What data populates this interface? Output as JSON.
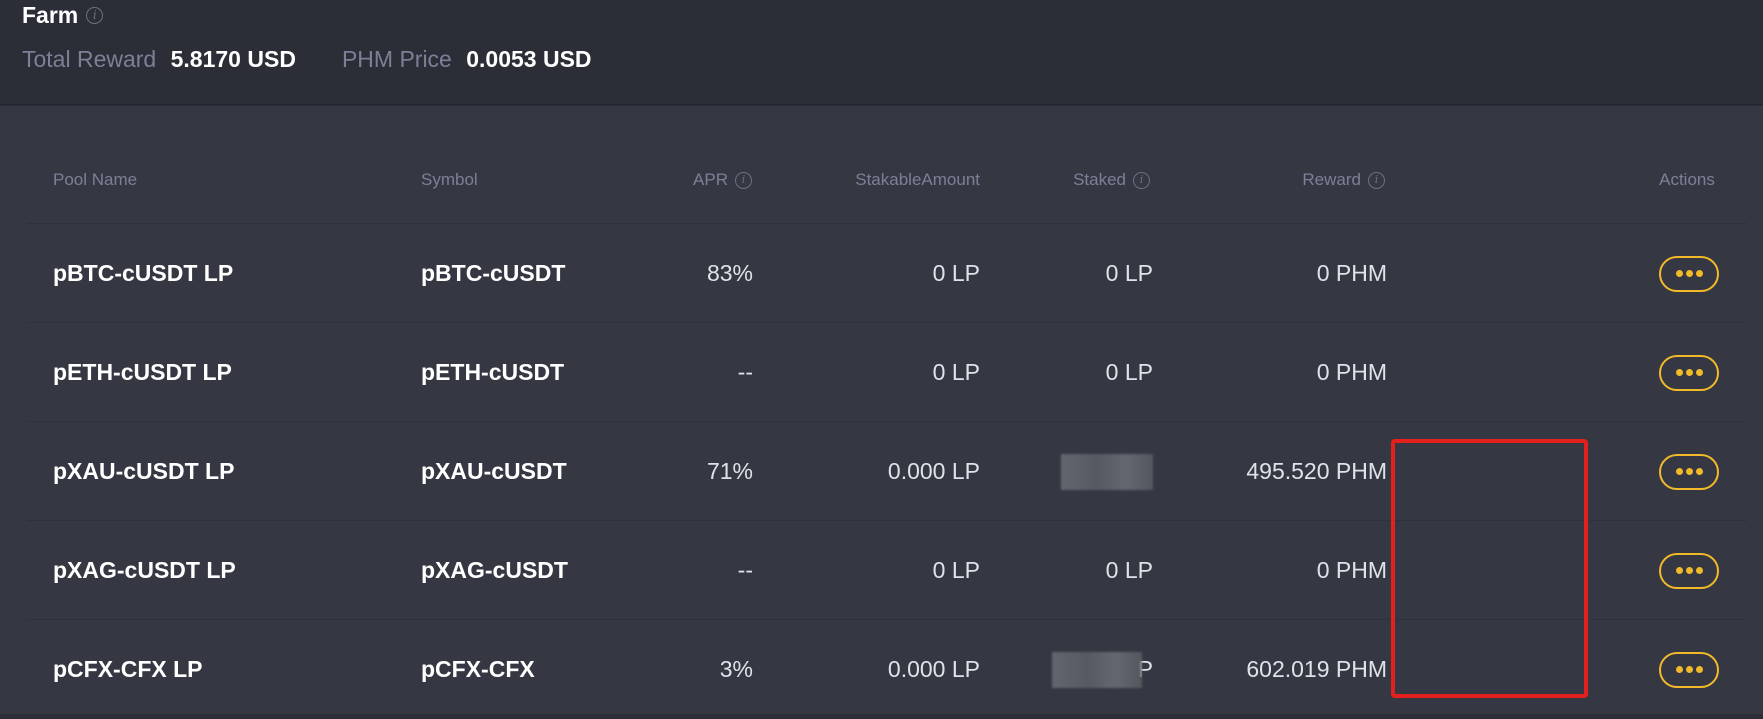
{
  "header": {
    "title": "Farm",
    "total_reward_label": "Total Reward",
    "total_reward_value": "5.8170 USD",
    "phm_price_label": "PHM Price",
    "phm_price_value": "0.0053 USD"
  },
  "table": {
    "columns": {
      "pool_name": "Pool Name",
      "symbol": "Symbol",
      "apr": "APR",
      "stakable": "StakableAmount",
      "staked": "Staked",
      "reward": "Reward",
      "actions": "Actions"
    },
    "rows": [
      {
        "pool": "pBTC-cUSDT LP",
        "symbol": "pBTC-cUSDT",
        "apr": "83%",
        "stakable": "0 LP",
        "staked": "0 LP",
        "reward": "0 PHM"
      },
      {
        "pool": "pETH-cUSDT LP",
        "symbol": "pETH-cUSDT",
        "apr": "--",
        "stakable": "0 LP",
        "staked": "0 LP",
        "reward": "0 PHM"
      },
      {
        "pool": "pXAU-cUSDT LP",
        "symbol": "pXAU-cUSDT",
        "apr": "71%",
        "stakable": "0.000 LP",
        "staked": "",
        "reward": "495.520 PHM"
      },
      {
        "pool": "pXAG-cUSDT LP",
        "symbol": "pXAG-cUSDT",
        "apr": "--",
        "stakable": "0 LP",
        "staked": "0 LP",
        "reward": "0 PHM"
      },
      {
        "pool": "pCFX-CFX LP",
        "symbol": "pCFX-CFX",
        "apr": "3%",
        "stakable": "0.000 LP",
        "staked": "P",
        "reward": "602.019 PHM"
      }
    ]
  },
  "icons": {
    "info": "info-icon",
    "more": "more-dots-icon"
  },
  "colors": {
    "accent": "#f2b929",
    "highlight": "#e3201b",
    "background": "#2b2e37",
    "panel": "#353843",
    "muted_text": "#7c8096"
  }
}
